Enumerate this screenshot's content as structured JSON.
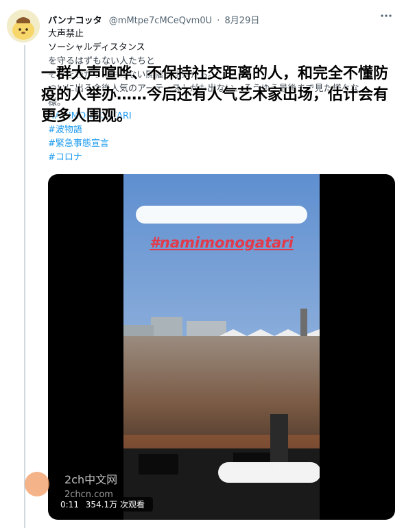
{
  "tweet": {
    "author_name": "パンナコッタ",
    "handle": "@mMtpe7cMCeQvm0U",
    "separator": "·",
    "date": "8月29日",
    "more_icon": "ellipsis-icon",
    "lines": [
      "大声禁止",
      "ソーシャルディスタンス",
      "を守るはずもない人たちと",
      "それをわかってやめない開催する人たち。",
      "ついに出る今後人気のアーティストがも出ない、そうゆう最後まで見た様々な",
      "様。"
    ],
    "partial_line": "NAMIMONOGATARI",
    "hashtags": [
      "#波物語",
      "#緊急事態宣言",
      "#コロナ"
    ]
  },
  "overlay_caption": "一群大声喧哗、不保持社交距离的人，和完全不懂防疫的人举办……今后还有人气艺术家出场，估计会有更多人围观。",
  "video": {
    "hashtag_text": "#namimonogatari",
    "duration": "0:11",
    "views": "354.1万 次观看"
  },
  "watermark": {
    "line1": "2ch中文网",
    "line2": "2chcn.com"
  },
  "colors": {
    "hashtag": "#1d9bf0",
    "overlay_hashtag": "#e23a4a",
    "sky": "#8fb3df",
    "crowd": "#7a5a44"
  }
}
